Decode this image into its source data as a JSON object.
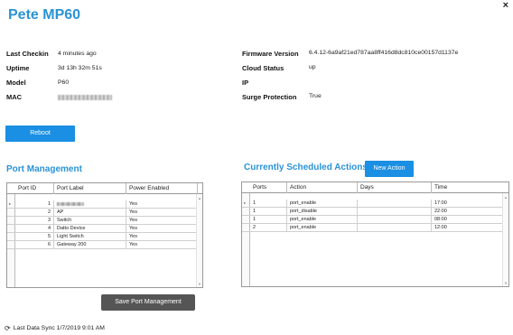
{
  "window": {
    "title": "Pete MP60",
    "close_label": "×"
  },
  "device_info_left": [
    {
      "label": "Last Checkin",
      "value": "4 minutes ago"
    },
    {
      "label": "Uptime",
      "value": "3d 13h 32m 51s"
    },
    {
      "label": "Model",
      "value": "P60"
    },
    {
      "label": "MAC",
      "value": ""
    }
  ],
  "device_info_right": [
    {
      "label": "Firmware Version",
      "value": "6.4.12-6a9af21ed787aa8ff416d8dc810ce00157d1137e"
    },
    {
      "label": "Cloud Status",
      "value": "up"
    },
    {
      "label": "IP",
      "value": ""
    },
    {
      "label": "Surge Protection",
      "value": "True"
    }
  ],
  "reboot_button": {
    "label": "Reboot"
  },
  "port_management": {
    "title": "Port Management",
    "columns": [
      "Port ID",
      "Port Label",
      "Power Enabled"
    ],
    "rows": [
      {
        "port_id": "1",
        "label": "",
        "power_enabled": "Yes",
        "label_redacted": true
      },
      {
        "port_id": "2",
        "label": "AP",
        "power_enabled": "Yes"
      },
      {
        "port_id": "3",
        "label": "Switch",
        "power_enabled": "Yes"
      },
      {
        "port_id": "4",
        "label": "Datto Device",
        "power_enabled": "Yes"
      },
      {
        "port_id": "5",
        "label": "Light Switch",
        "power_enabled": "Yes"
      },
      {
        "port_id": "6",
        "label": "Gateway 200",
        "power_enabled": "Yes"
      }
    ],
    "save_label": "Save Port Management"
  },
  "scheduled_actions": {
    "title": "Currently Scheduled Actions",
    "new_action_label": "New Action",
    "columns": [
      "Ports",
      "Action",
      "Days",
      "Time"
    ],
    "rows": [
      {
        "ports": "1",
        "action": "port_enable",
        "days": "",
        "time": "17:00"
      },
      {
        "ports": "1",
        "action": "port_disable",
        "days": "",
        "time": "22:00"
      },
      {
        "ports": "1",
        "action": "port_enable",
        "days": "",
        "time": "08:00"
      },
      {
        "ports": "2",
        "action": "port_enable",
        "days": "",
        "time": "12:00"
      }
    ]
  },
  "footer": {
    "sync_text": "Last Data Sync 1/7/2019 9:01 AM",
    "sync_icon": "refresh-icon"
  },
  "colors": {
    "accent": "#2a93d5",
    "button_blue": "#1a8fe3",
    "button_gray": "#555555"
  }
}
